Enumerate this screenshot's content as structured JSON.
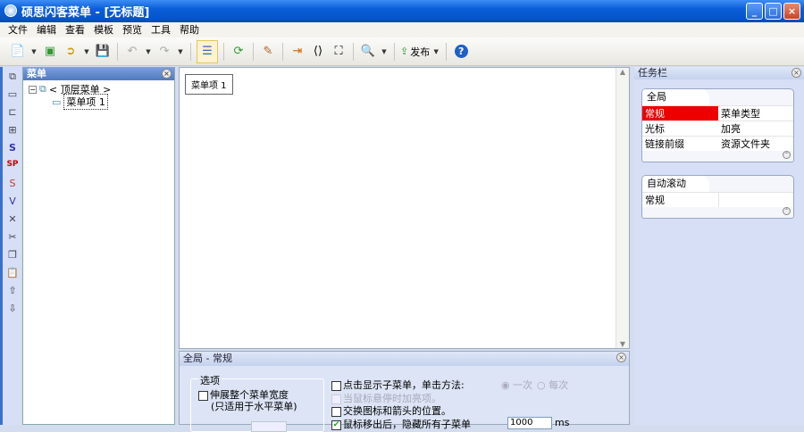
{
  "window": {
    "title": "硕思闪客菜单 - [无标题]"
  },
  "menubar": [
    "文件",
    "编辑",
    "查看",
    "模板",
    "预览",
    "工具",
    "帮助"
  ],
  "toolbar": {
    "publish_label": "发布"
  },
  "menu_panel": {
    "title": "菜单",
    "root": "< 顶层菜单 >",
    "item": "菜单项 1"
  },
  "canvas": {
    "menu_item": "菜单项 1"
  },
  "props": {
    "title": "全局 - 常规",
    "group_title": "选项",
    "stretch_label": "伸展整个菜单宽度",
    "stretch_note": "(只适用于水平菜单)",
    "click_show": "点击显示子菜单，单击方法:",
    "radio_once": "一次",
    "radio_each": "每次",
    "hover_highlight": "当鼠标悬停时加亮项。",
    "swap_icon": "交换图标和箭头的位置。",
    "hide_sub": "鼠标移出后，隐藏所有子菜单",
    "delay_value": "1000",
    "delay_unit": "ms"
  },
  "taskpane": {
    "title": "任务栏",
    "groups": [
      {
        "title": "全局",
        "items": [
          "常规",
          "菜单类型",
          "光标",
          "加亮",
          "链接前缀",
          "资源文件夹"
        ]
      },
      {
        "title": "自动滚动",
        "items": [
          "常规",
          ""
        ]
      }
    ]
  },
  "colors": {
    "titlebar": "#0653c9",
    "selected": "#ee0000"
  }
}
